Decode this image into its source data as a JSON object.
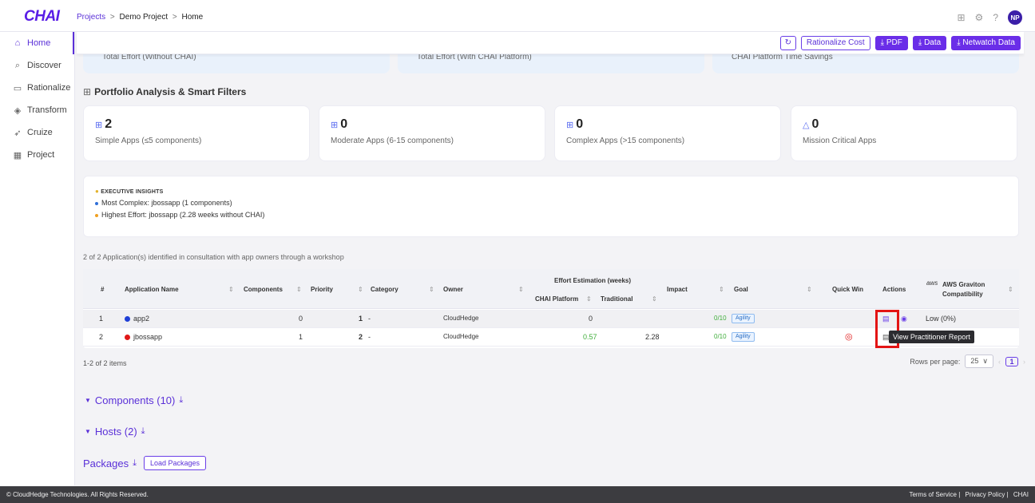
{
  "header": {
    "logo": "CHAI",
    "breadcrumb": {
      "projects": "Projects",
      "project": "Demo Project",
      "page": "Home"
    },
    "avatar_initials": "NP"
  },
  "sidebar": {
    "items": [
      {
        "label": "Home",
        "icon": "home-icon"
      },
      {
        "label": "Discover",
        "icon": "search-icon"
      },
      {
        "label": "Rationalize",
        "icon": "monitor-icon"
      },
      {
        "label": "Transform",
        "icon": "cube-icon"
      },
      {
        "label": "Cruize",
        "icon": "rocket-icon"
      },
      {
        "label": "Project",
        "icon": "calendar-icon"
      }
    ]
  },
  "actions": {
    "rationalize_cost": "Rationalize Cost",
    "pdf": "PDF",
    "data": "Data",
    "netwatch": "Netwatch Data"
  },
  "effort_cards": [
    "Total Effort (Without CHAI)",
    "Total Effort (With CHAI Platform)",
    "CHAI Platform Time Savings"
  ],
  "portfolio": {
    "title": "Portfolio Analysis & Smart Filters",
    "cards": [
      {
        "value": "2",
        "label": "Simple Apps (≤5 components)"
      },
      {
        "value": "0",
        "label": "Moderate Apps (6-15 components)"
      },
      {
        "value": "0",
        "label": "Complex Apps (>15 components)"
      },
      {
        "value": "0",
        "label": "Mission Critical Apps"
      }
    ]
  },
  "insights": {
    "title": "EXECUTIVE INSIGHTS",
    "lines": [
      "Most Complex: jbossapp (1 components)",
      "Highest Effort: jbossapp (2.28 weeks without CHAI)"
    ],
    "colors": [
      "#2f6fd8",
      "#f0a020"
    ]
  },
  "identified_text": "2 of 2 Application(s) identified in consultation with app owners through a workshop",
  "table": {
    "headers": {
      "num": "#",
      "name": "Application Name",
      "components": "Components",
      "priority": "Priority",
      "category": "Category",
      "owner": "Owner",
      "effort": "Effort Estimation (weeks)",
      "chai": "CHAI Platform",
      "traditional": "Traditional",
      "impact": "Impact",
      "goal": "Goal",
      "quickwin": "Quick Win",
      "actions": "Actions",
      "aws_logo": "aws",
      "graviton": "AWS Graviton Compatibility"
    },
    "rows": [
      {
        "num": "1",
        "name": "app2",
        "dot": "#1f3fd6",
        "components": "0",
        "priority": "1",
        "category": "-",
        "owner": "CloudHedge",
        "chai": "0",
        "traditional": "",
        "impact": "0/10",
        "goal": "Agility",
        "quickwin": false,
        "graviton": "Low (0%)"
      },
      {
        "num": "2",
        "name": "jbossapp",
        "dot": "#e01818",
        "components": "1",
        "priority": "2",
        "category": "-",
        "owner": "CloudHedge",
        "chai": "0.57",
        "traditional": "2.28",
        "impact": "0/10",
        "goal": "Agility",
        "quickwin": true,
        "graviton": ""
      }
    ],
    "tooltip": "View Practitioner Report"
  },
  "pagination": {
    "summary": "1-2 of 2 items",
    "rows_per_page_label": "Rows per page:",
    "rows_per_page": "25",
    "page": "1"
  },
  "sections": {
    "components": "Components (10)",
    "hosts": "Hosts (2)",
    "packages": "Packages",
    "load_packages": "Load Packages"
  },
  "footer": {
    "copyright": "© CloudHedge Technologies. All Rights Reserved.",
    "terms": "Terms of Service",
    "privacy": "Privacy Policy",
    "brand": "CHAI"
  }
}
